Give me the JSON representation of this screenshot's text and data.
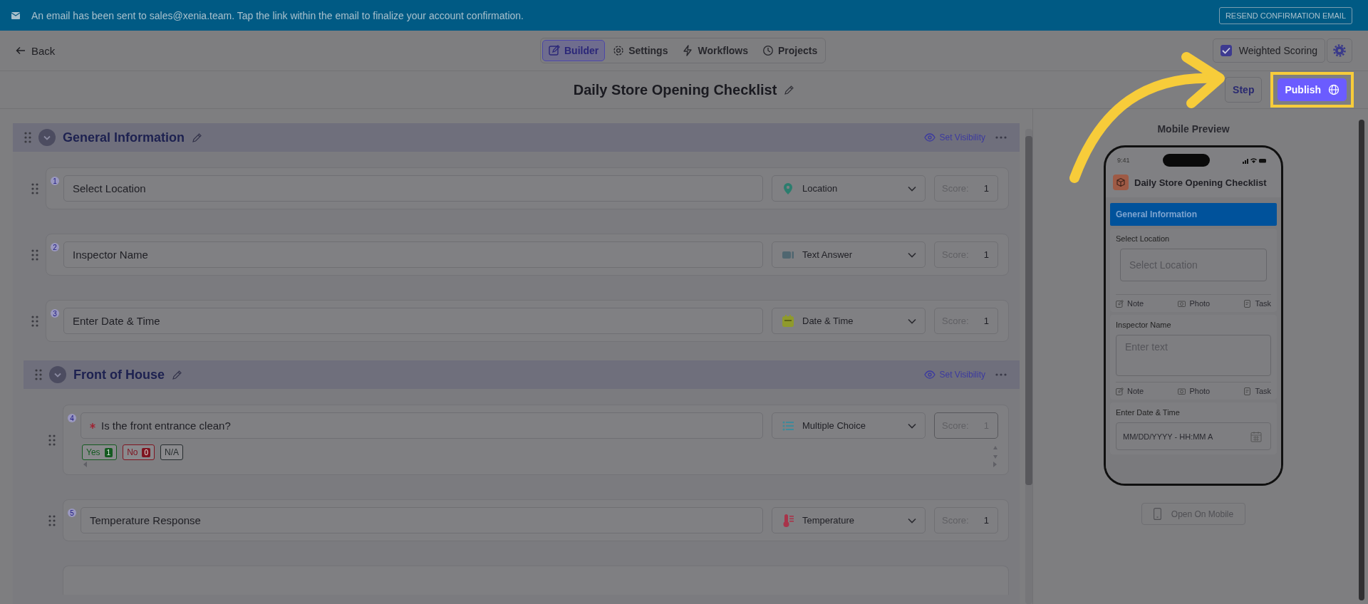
{
  "banner": {
    "message": "An email has been sent to sales@xenia.team. Tap the link within the email to finalize your account confirmation.",
    "button": "RESEND CONFIRMATION EMAIL"
  },
  "header": {
    "back": "Back",
    "tabs": [
      {
        "label": "Builder",
        "kind": "builder",
        "selected": true
      },
      {
        "label": "Settings",
        "kind": "settings",
        "selected": false
      },
      {
        "label": "Workflows",
        "kind": "workflows",
        "selected": false
      },
      {
        "label": "Projects",
        "kind": "projects",
        "selected": false
      }
    ],
    "weighted_scoring": {
      "label": "Weighted Scoring",
      "checked": true
    }
  },
  "title": "Daily Store Opening Checklist",
  "step_button": "Step",
  "publish_button": "Publish",
  "sections": [
    {
      "title": "General Information",
      "set_visibility": "Set Visibility",
      "questions": [
        {
          "number": "1",
          "text": "Select Location",
          "required": false,
          "type": {
            "label": "Location",
            "kind": "location"
          },
          "score_label": "Score:",
          "score": "1"
        },
        {
          "number": "2",
          "text": "Inspector Name",
          "required": false,
          "type": {
            "label": "Text Answer",
            "kind": "text"
          },
          "score_label": "Score:",
          "score": "1"
        },
        {
          "number": "3",
          "text": "Enter Date & Time",
          "required": false,
          "type": {
            "label": "Date & Time",
            "kind": "date"
          },
          "score_label": "Score:",
          "score": "1"
        }
      ]
    },
    {
      "title": "Front of House",
      "set_visibility": "Set Visibility",
      "questions": [
        {
          "number": "4",
          "text": "Is the front entrance clean?",
          "required": true,
          "type": {
            "label": "Multiple Choice",
            "kind": "choice"
          },
          "score_label": "Score:",
          "score": "1",
          "options": [
            {
              "label": "Yes",
              "score": "1",
              "color": "#145a20"
            },
            {
              "label": "No",
              "score": "0",
              "color": "#7e1420"
            },
            {
              "label": "N/A",
              "color": "#262c2e"
            }
          ]
        },
        {
          "number": "5",
          "text": "Temperature Response",
          "required": false,
          "type": {
            "label": "Temperature",
            "kind": "temperature"
          },
          "score_label": "Score:",
          "score": "1"
        }
      ]
    }
  ],
  "preview": {
    "title": "Mobile Preview",
    "time": "9:41",
    "form_title": "Daily Store Opening Checklist",
    "section": "General Information",
    "fields": [
      {
        "label": "Select Location",
        "kind": "select",
        "placeholder": "Select Location",
        "actions": [
          "Note",
          "Photo",
          "Task"
        ]
      },
      {
        "label": "Inspector Name",
        "kind": "text",
        "placeholder": "Enter text",
        "actions": [
          "Note",
          "Photo",
          "Task"
        ]
      },
      {
        "label": "Enter Date & Time",
        "kind": "datetime",
        "placeholder": "MM/DD/YYYY - HH:MM A"
      }
    ],
    "open_button": "Open On Mobile"
  }
}
